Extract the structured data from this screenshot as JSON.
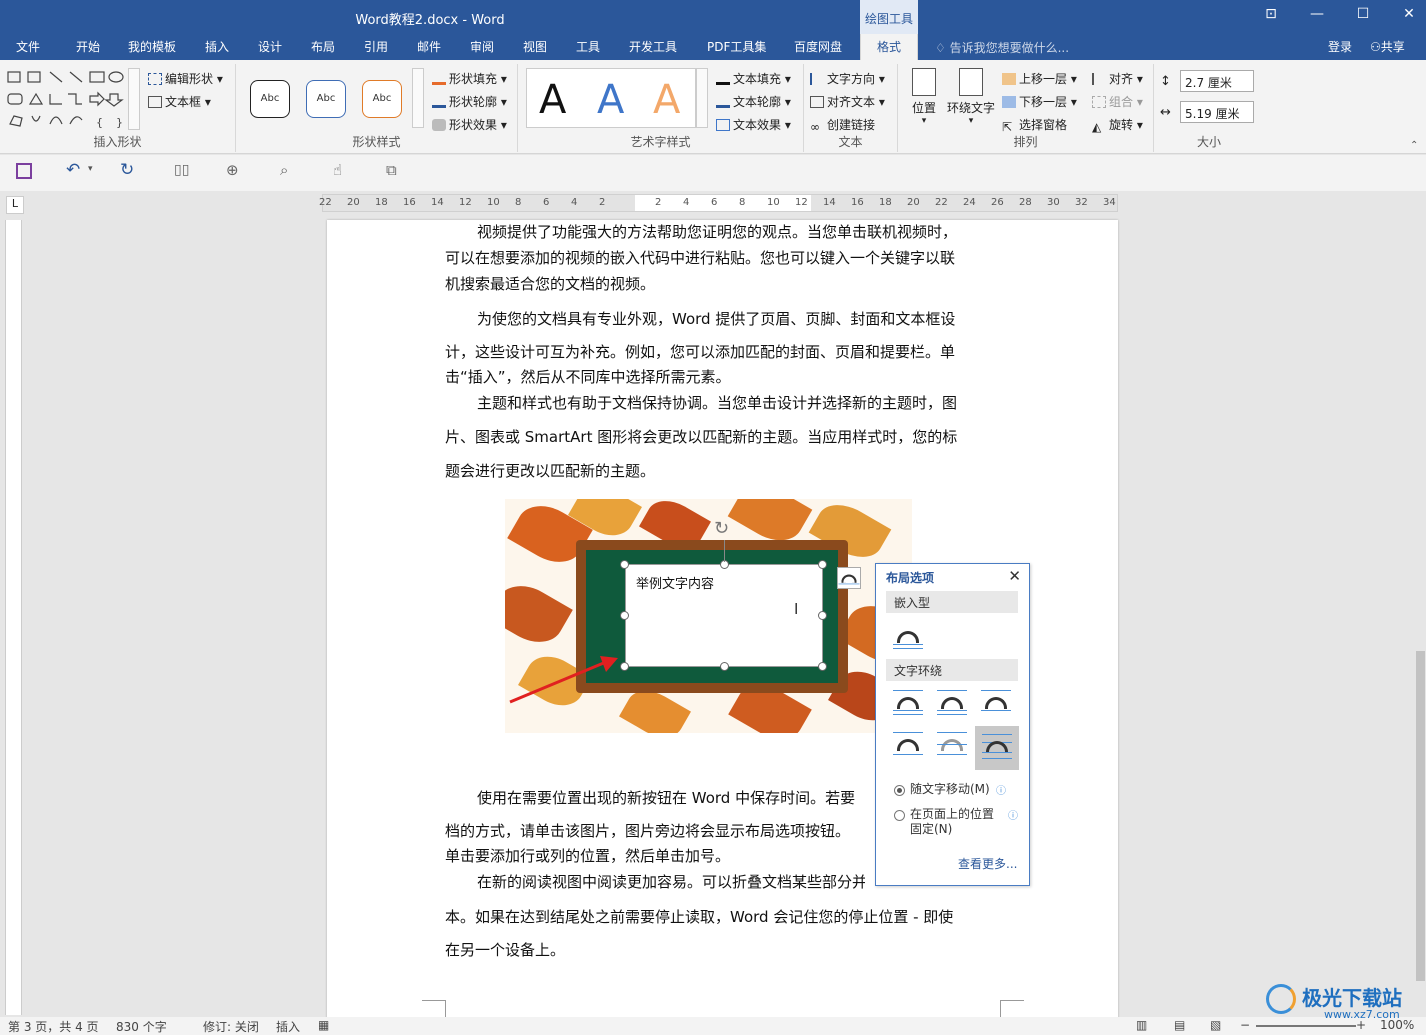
{
  "window": {
    "title": "Word教程2.docx - Word",
    "context_title": "绘图工具"
  },
  "tabs": [
    {
      "label": "文件"
    },
    {
      "label": "开始"
    },
    {
      "label": "我的模板"
    },
    {
      "label": "插入"
    },
    {
      "label": "设计"
    },
    {
      "label": "布局"
    },
    {
      "label": "引用"
    },
    {
      "label": "邮件"
    },
    {
      "label": "审阅"
    },
    {
      "label": "视图"
    },
    {
      "label": "工具"
    },
    {
      "label": "开发工具"
    },
    {
      "label": "PDF工具集"
    },
    {
      "label": "百度网盘"
    },
    {
      "label": "格式"
    }
  ],
  "tellme": "告诉我您想要做什么...",
  "account": {
    "login": "登录",
    "share": "共享"
  },
  "ribbon": {
    "insert_shapes": {
      "label": "插入形状",
      "edit_shape": "编辑形状",
      "textbox": "文本框"
    },
    "shape_styles": {
      "label": "形状样式",
      "sample": "Abc",
      "fill": "形状填充",
      "outline": "形状轮廓",
      "effects": "形状效果"
    },
    "wordart": {
      "label": "艺术字样式",
      "letter": "A",
      "text_fill": "文本填充",
      "text_outline": "文本轮廓",
      "text_effects": "文本效果"
    },
    "text": {
      "label": "文本",
      "direction": "文字方向",
      "align": "对齐文本",
      "link": "创建链接"
    },
    "arrange": {
      "label": "排列",
      "position": "位置",
      "wrap": "环绕文字",
      "bring_forward": "上移一层",
      "send_backward": "下移一层",
      "selection_pane": "选择窗格",
      "align": "对齐",
      "group": "组合",
      "rotate": "旋转"
    },
    "size": {
      "label": "大小",
      "height": "2.7 厘米",
      "width": "5.19 厘米"
    }
  },
  "ruler": {
    "h_ticks": [
      "22",
      "20",
      "18",
      "16",
      "14",
      "12",
      "10",
      "8",
      "6",
      "4",
      "2",
      "",
      "2",
      "4",
      "6",
      "8",
      "10",
      "12",
      "14",
      "16",
      "18",
      "20",
      "22",
      "24",
      "26",
      "28",
      "30",
      "32",
      "34"
    ]
  },
  "document": {
    "paragraphs": [
      "视频提供了功能强大的方法帮助您证明您的观点。当您单击联机视频时，",
      "可以在想要添加的视频的嵌入代码中进行粘贴。您也可以键入一个关键字以联",
      "机搜索最适合您的文档的视频。",
      "为使您的文档具有专业外观，Word 提供了页眉、页脚、封面和文本框设",
      "计，这些设计可互为补充。例如，您可以添加匹配的封面、页眉和提要栏。单",
      "击“插入”，然后从不同库中选择所需元素。",
      "主题和样式也有助于文档保持协调。当您单击设计并选择新的主题时，图",
      "片、图表或 SmartArt 图形将会更改以匹配新的主题。当应用样式时，您的标",
      "题会进行更改以匹配新的主题。",
      "使用在需要位置出现的新按钮在 Word 中保存时间。若要",
      "档的方式，请单击该图片，图片旁边将会显示布局选项按钮。",
      "单击要添加行或列的位置，然后单击加号。",
      "在新的阅读视图中阅读更加容易。可以折叠文档某些部分并关注所需文",
      "本。如果在达到结尾处之前需要停止读取，Word 会记住您的停止位置 - 即使",
      "在另一个设备上。"
    ],
    "textbox_text": "举例文字内容"
  },
  "layout_panel": {
    "title": "布局选项",
    "close": "✕",
    "inline_section": "嵌入型",
    "wrap_section": "文字环绕",
    "move_with_text": "随文字移动(M)",
    "fix_position": "在页面上的位置固定(N)",
    "see_more": "查看更多..."
  },
  "status": {
    "page": "第 3 页，共 4 页",
    "words": "830 个字",
    "track": "修订: 关闭",
    "mode": "插入",
    "zoom": "100%"
  },
  "watermark": {
    "brand": "极光下载站",
    "url": "www.xz7.com"
  }
}
